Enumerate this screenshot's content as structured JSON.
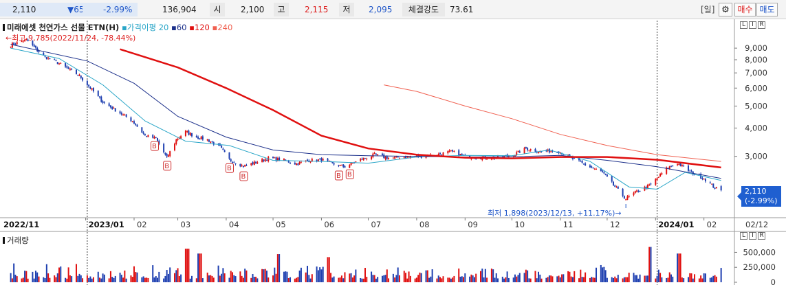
{
  "header": {
    "price": "2,110",
    "change": "▼65",
    "change_pct": "-2.99%",
    "volume": "136,904",
    "open_label": "시",
    "open_value": "2,100",
    "high_label": "고",
    "high_value": "2,115",
    "low_label": "저",
    "low_value": "2,095",
    "strength_label": "체결강도",
    "strength_value": "73.61",
    "period_label": "[일]",
    "buy_label": "매수",
    "sell_label": "매도",
    "settings_icon": "gear-icon"
  },
  "legend": {
    "name": "미래에셋 천연가스 선물 ETN(H)",
    "ma_label": "가격이평",
    "ma20": "20",
    "ma60": "60",
    "ma120": "120",
    "ma240": "240",
    "colors": {
      "ma20": "#2aa6c8",
      "ma60": "#1b2f8a",
      "ma120": "#e01010",
      "ma240": "#f06050",
      "up": "#e01010",
      "down": "#1e3fb0"
    }
  },
  "annotations": {
    "high": "←최고 9,785(2022/11/24, -78.44%)",
    "low": "최저 1,898(2023/12/13, +11.17%)→"
  },
  "price_tag": {
    "line1": "2,110",
    "line2": "(-2.99%)"
  },
  "axis_buttons": [
    "L",
    "I",
    "R"
  ],
  "volume_label": "거래량",
  "chart_data": [
    {
      "type": "candlestick",
      "title": "미래에셋 천연가스 선물 ETN(H)",
      "y_scale": "log",
      "ylim": [
        1750,
        10500
      ],
      "y_ticks": [
        9000,
        8000,
        7000,
        6000,
        5000,
        4000,
        3000
      ],
      "y_tick_labels": [
        "9,000",
        "8,000",
        "7,000",
        "6,000",
        "5,000",
        "4,000",
        "3,000"
      ],
      "x_tick_labels": [
        "2022/11",
        "2023/01",
        "02",
        "03",
        "04",
        "05",
        "06",
        "07",
        "08",
        "09",
        "10",
        "11",
        "12",
        "2024/01",
        "02",
        "02/12"
      ],
      "close_keypoints": [
        [
          "2022-11-14",
          9300
        ],
        [
          "2022-11-24",
          9785
        ],
        [
          "2022-12-05",
          8300
        ],
        [
          "2022-12-15",
          7700
        ],
        [
          "2022-12-28",
          6800
        ],
        [
          "2023-01-05",
          5900
        ],
        [
          "2023-01-12",
          5200
        ],
        [
          "2023-01-20",
          4800
        ],
        [
          "2023-01-31",
          4300
        ],
        [
          "2023-02-08",
          3700
        ],
        [
          "2023-02-15",
          3600
        ],
        [
          "2023-02-22",
          2950
        ],
        [
          "2023-02-28",
          3550
        ],
        [
          "2023-03-06",
          3850
        ],
        [
          "2023-03-13",
          3650
        ],
        [
          "2023-03-20",
          3550
        ],
        [
          "2023-03-28",
          3300
        ],
        [
          "2023-04-03",
          2900
        ],
        [
          "2023-04-12",
          2720
        ],
        [
          "2023-04-20",
          2820
        ],
        [
          "2023-04-28",
          2950
        ],
        [
          "2023-05-08",
          2880
        ],
        [
          "2023-05-16",
          2780
        ],
        [
          "2023-05-24",
          2880
        ],
        [
          "2023-06-01",
          2900
        ],
        [
          "2023-06-08",
          2780
        ],
        [
          "2023-06-16",
          2700
        ],
        [
          "2023-06-26",
          2900
        ],
        [
          "2023-07-05",
          3050
        ],
        [
          "2023-07-14",
          2950
        ],
        [
          "2023-07-25",
          2980
        ],
        [
          "2023-08-03",
          3000
        ],
        [
          "2023-08-14",
          3050
        ],
        [
          "2023-08-23",
          3150
        ],
        [
          "2023-09-01",
          3000
        ],
        [
          "2023-09-12",
          2960
        ],
        [
          "2023-09-21",
          2950
        ],
        [
          "2023-10-02",
          3050
        ],
        [
          "2023-10-10",
          3250
        ],
        [
          "2023-10-19",
          3150
        ],
        [
          "2023-10-30",
          3180
        ],
        [
          "2023-11-08",
          2950
        ],
        [
          "2023-11-17",
          2750
        ],
        [
          "2023-11-28",
          2550
        ],
        [
          "2023-12-06",
          2200
        ],
        [
          "2023-12-13",
          1950
        ],
        [
          "2023-12-20",
          2100
        ],
        [
          "2023-12-29",
          2250
        ],
        [
          "2024-01-08",
          2650
        ],
        [
          "2024-01-15",
          2800
        ],
        [
          "2024-01-24",
          2550
        ],
        [
          "2024-02-01",
          2400
        ],
        [
          "2024-02-08",
          2180
        ],
        [
          "2024-02-12",
          2110
        ]
      ],
      "buy_signals": [
        "2023-02-14",
        "2023-02-22",
        "2023-04-03",
        "2023-04-12",
        "2023-06-12",
        "2023-06-19"
      ],
      "buy_signal_label": "B",
      "vertical_markers": [
        "2023-01-02",
        "2024-01-02"
      ],
      "moving_averages": {
        "ma20": [
          [
            "2022-11-14",
            9000
          ],
          [
            "2022-12-15",
            8100
          ],
          [
            "2023-01-12",
            6200
          ],
          [
            "2023-02-08",
            4300
          ],
          [
            "2023-03-06",
            3500
          ],
          [
            "2023-04-03",
            3350
          ],
          [
            "2023-05-01",
            2880
          ],
          [
            "2023-06-01",
            2850
          ],
          [
            "2023-07-01",
            2800
          ],
          [
            "2023-08-01",
            2980
          ],
          [
            "2023-09-01",
            3030
          ],
          [
            "2023-10-01",
            3020
          ],
          [
            "2023-10-25",
            3200
          ],
          [
            "2023-11-20",
            2850
          ],
          [
            "2023-12-15",
            2200
          ],
          [
            "2024-01-02",
            2150
          ],
          [
            "2024-01-20",
            2550
          ],
          [
            "2024-02-12",
            2350
          ]
        ],
        "ma60": [
          [
            "2022-11-14",
            9350
          ],
          [
            "2023-01-02",
            7900
          ],
          [
            "2023-02-01",
            6300
          ],
          [
            "2023-03-01",
            4500
          ],
          [
            "2023-04-01",
            3650
          ],
          [
            "2023-05-01",
            3200
          ],
          [
            "2023-06-01",
            3050
          ],
          [
            "2023-07-01",
            3020
          ],
          [
            "2023-08-01",
            3000
          ],
          [
            "2023-09-01",
            2980
          ],
          [
            "2023-10-01",
            2990
          ],
          [
            "2023-11-01",
            3030
          ],
          [
            "2023-12-01",
            2880
          ],
          [
            "2024-01-02",
            2700
          ],
          [
            "2024-02-12",
            2400
          ]
        ],
        "ma120": [
          [
            "2023-01-23",
            8900
          ],
          [
            "2023-03-01",
            7400
          ],
          [
            "2023-04-01",
            6000
          ],
          [
            "2023-05-01",
            4800
          ],
          [
            "2023-06-01",
            3700
          ],
          [
            "2023-07-01",
            3250
          ],
          [
            "2023-08-01",
            3050
          ],
          [
            "2023-09-01",
            2960
          ],
          [
            "2023-10-01",
            2940
          ],
          [
            "2023-11-01",
            2980
          ],
          [
            "2023-12-01",
            2980
          ],
          [
            "2024-01-02",
            2900
          ],
          [
            "2024-02-12",
            2680
          ]
        ],
        "ma240": [
          [
            "2023-07-11",
            6200
          ],
          [
            "2023-08-01",
            5800
          ],
          [
            "2023-09-01",
            5000
          ],
          [
            "2023-10-01",
            4400
          ],
          [
            "2023-11-01",
            3750
          ],
          [
            "2023-12-01",
            3350
          ],
          [
            "2024-01-02",
            3050
          ],
          [
            "2024-02-12",
            2850
          ]
        ]
      },
      "last_close": 2110
    },
    {
      "type": "bar",
      "title": "거래량",
      "ylim": [
        0,
        700000
      ],
      "y_ticks": [
        0,
        250000,
        500000
      ],
      "y_tick_labels": [
        "0",
        "250,000",
        "500,000"
      ],
      "x_range": [
        "2022-11-14",
        "2024-02-12"
      ],
      "peak_volumes": [
        [
          "2023-03-07",
          560000
        ],
        [
          "2023-03-15",
          480000
        ],
        [
          "2023-05-05",
          470000
        ],
        [
          "2023-06-05",
          420000
        ],
        [
          "2023-12-29",
          590000
        ],
        [
          "2024-01-16",
          480000
        ]
      ],
      "typical_volume": [
        60000,
        220000
      ]
    }
  ]
}
